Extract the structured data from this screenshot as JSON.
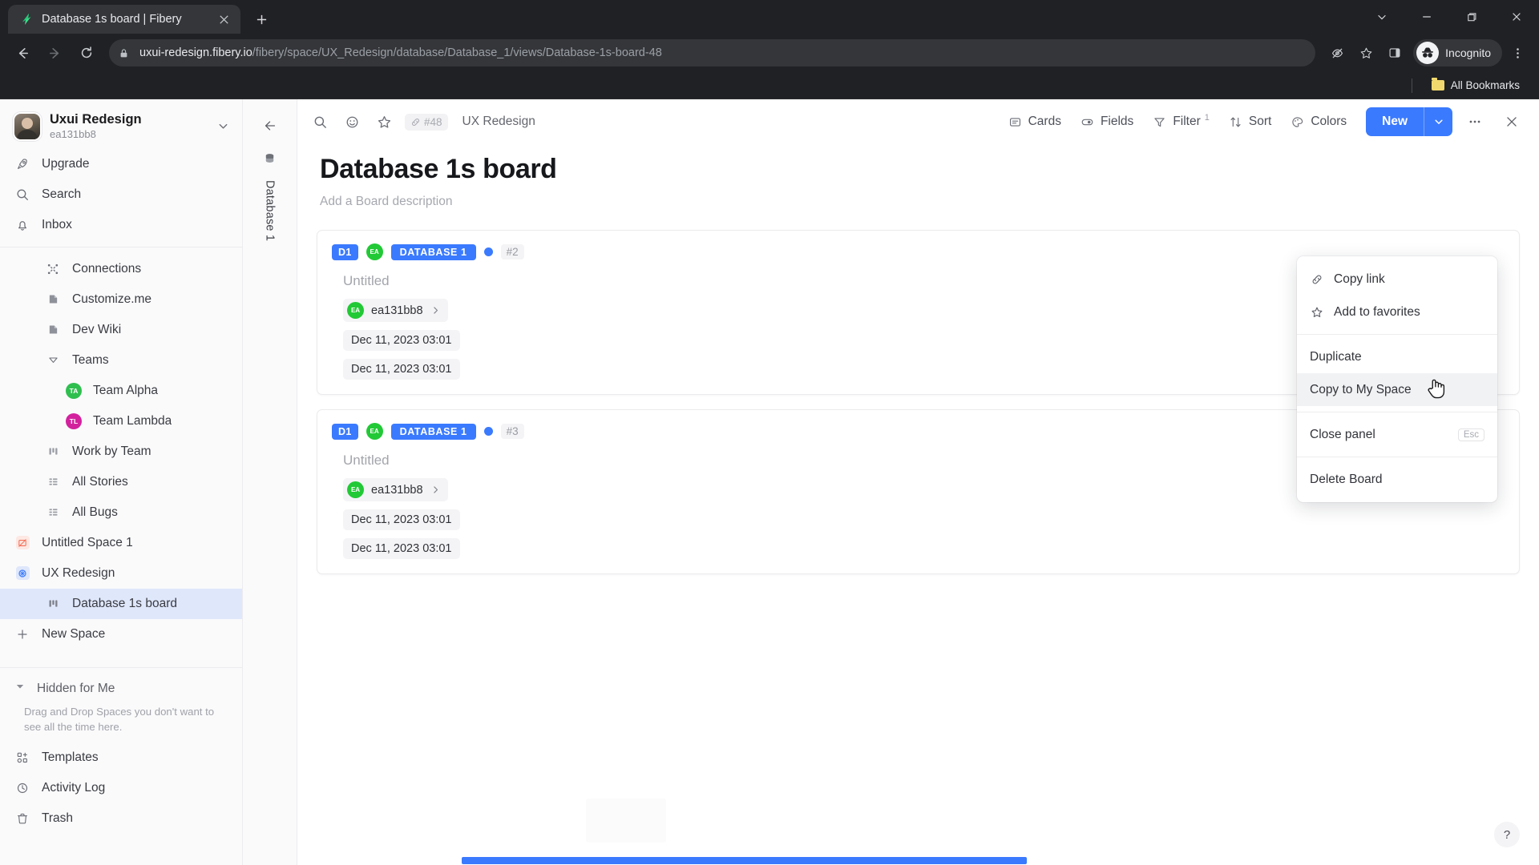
{
  "browser": {
    "tab": {
      "title": "Database 1s board | Fibery",
      "favicon_name": "fibery-logo-icon",
      "close_label": "✕"
    },
    "new_tab_label": "+",
    "window_controls": {
      "minimize": "—",
      "maximize": "❐",
      "close": "✕",
      "tab_search": "⌄"
    },
    "nav": {
      "back": "←",
      "forward": "→",
      "reload": "↻"
    },
    "url": {
      "host": "uxui-redesign.fibery.io",
      "path": "/fibery/space/UX_Redesign/database/Database_1/views/Database-1s-board-48"
    },
    "omnibox_actions": {
      "tracking_protection": "eye-off-icon",
      "bookmark": "star-icon",
      "side_panel": "side-panel-icon",
      "menu": "kebab-menu-icon"
    },
    "profile": {
      "label": "Incognito"
    },
    "bookmarks": {
      "all_bookmarks_label": "All Bookmarks"
    }
  },
  "sidebar": {
    "workspace": {
      "name": "Uxui Redesign",
      "account": "ea131bb8",
      "caret": "⌄"
    },
    "primary": [
      {
        "label": "Upgrade",
        "icon": "rocket-icon"
      },
      {
        "label": "Search",
        "icon": "search-icon"
      },
      {
        "label": "Inbox",
        "icon": "bell-icon"
      }
    ],
    "spaces": [
      {
        "label": "Connections",
        "icon": "connections-icon",
        "indent": 1
      },
      {
        "label": "Customize.me",
        "icon": "doc-icon",
        "indent": 1
      },
      {
        "label": "Dev Wiki",
        "icon": "doc-icon",
        "indent": 1
      },
      {
        "label": "Teams",
        "icon": "chevron-down-icon",
        "indent": 1
      }
    ],
    "teams": [
      {
        "label": "Team Alpha",
        "initials": "TA",
        "color": "#2fbf4f"
      },
      {
        "label": "Team Lambda",
        "initials": "TL",
        "color": "#d3219e"
      }
    ],
    "views": [
      {
        "label": "Work by Team",
        "icon": "board-icon"
      },
      {
        "label": "All Stories",
        "icon": "grid-icon"
      },
      {
        "label": "All Bugs",
        "icon": "grid-icon"
      }
    ],
    "top_spaces": [
      {
        "label": "Untitled Space 1",
        "icon": "space-icon",
        "color": "#f4a08e",
        "bg": "#fde8e3"
      },
      {
        "label": "UX Redesign",
        "icon": "space-icon",
        "color": "#3a7afe",
        "bg": "#dfe7fb"
      }
    ],
    "active_view": {
      "label": "Database 1s board",
      "icon": "board-icon"
    },
    "new_space": {
      "label": "New Space",
      "icon": "plus-icon"
    },
    "hidden": {
      "label": "Hidden for Me",
      "note": "Drag and Drop Spaces you don't want to see all the time here."
    },
    "bottom": [
      {
        "label": "Templates",
        "icon": "templates-icon"
      },
      {
        "label": "Activity Log",
        "icon": "clock-icon"
      },
      {
        "label": "Trash",
        "icon": "trash-icon"
      }
    ]
  },
  "rail": {
    "back_icon": "back-arrow-icon",
    "db_icon": "database-icon",
    "label": "Database 1"
  },
  "toolbar": {
    "left_icons": [
      {
        "name": "search-icon"
      },
      {
        "name": "emoji-icon"
      },
      {
        "name": "star-icon"
      }
    ],
    "entity_id": "#48",
    "space_name": "UX Redesign",
    "buttons": [
      {
        "label": "Cards",
        "icon": "cards-icon",
        "sup": ""
      },
      {
        "label": "Fields",
        "icon": "fields-icon",
        "sup": ""
      },
      {
        "label": "Filter",
        "icon": "filter-icon",
        "sup": "1"
      },
      {
        "label": "Sort",
        "icon": "sort-icon",
        "sup": ""
      },
      {
        "label": "Colors",
        "icon": "palette-icon",
        "sup": ""
      }
    ],
    "new_label": "New",
    "new_caret": "⌄",
    "more_icon": "ellipsis-icon",
    "close_icon": "close-icon"
  },
  "board": {
    "title": "Database 1s board",
    "description_placeholder": "Add a Board description",
    "cards": [
      {
        "tag_short": "D1",
        "avatar_initials": "EA",
        "tag_database": "DATABASE 1",
        "state_dot_color": "#3a7afe",
        "number": "#2",
        "title": "Untitled",
        "owner": "ea131bb8",
        "owner_initials": "EA",
        "created": "Dec 11, 2023 03:01",
        "modified": "Dec 11, 2023 03:01"
      },
      {
        "tag_short": "D1",
        "avatar_initials": "EA",
        "tag_database": "DATABASE 1",
        "state_dot_color": "#3a7afe",
        "number": "#3",
        "title": "Untitled",
        "owner": "ea131bb8",
        "owner_initials": "EA",
        "created": "Dec 11, 2023 03:01",
        "modified": "Dec 11, 2023 03:01"
      }
    ]
  },
  "context_menu": {
    "items": [
      {
        "label": "Copy link",
        "icon": "link-icon",
        "kbd": "",
        "hover": false
      },
      {
        "label": "Add to favorites",
        "icon": "star-icon",
        "kbd": "",
        "hover": false
      },
      {
        "label": "Duplicate",
        "icon": "",
        "kbd": "",
        "hover": false
      },
      {
        "label": "Copy to My Space",
        "icon": "",
        "kbd": "",
        "hover": true
      },
      {
        "label": "Close panel",
        "icon": "",
        "kbd": "Esc",
        "hover": false
      },
      {
        "label": "Delete Board",
        "icon": "",
        "kbd": "",
        "hover": false
      }
    ]
  },
  "help": {
    "label": "?"
  }
}
